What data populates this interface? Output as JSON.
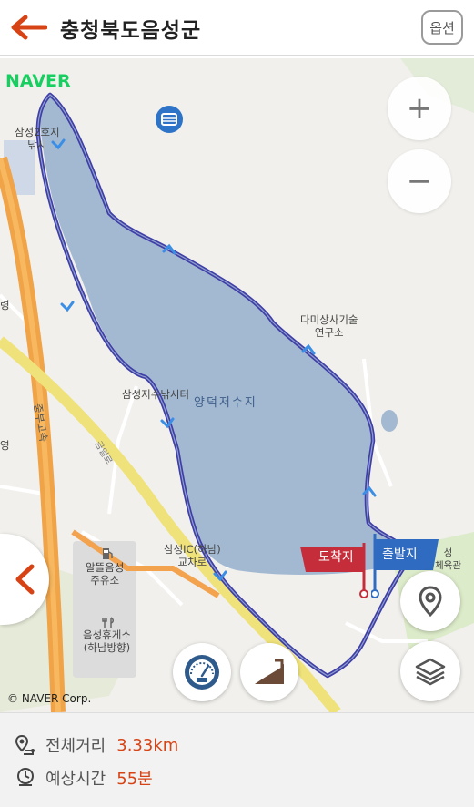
{
  "header": {
    "title": "충청북도음성군",
    "options_label": "옵션"
  },
  "map": {
    "logo": "NAVER",
    "copyright": "© NAVER Corp.",
    "zoom_in": "+",
    "zoom_out": "−",
    "labels": {
      "fishing_site": "삼성2호지\n낚시",
      "research_center": "다미상사기술\n연구소",
      "fishing_center": "삼성저수낚시터",
      "lake": "양덕저수지",
      "highway": "중부고속",
      "road": "금일로",
      "ic": "삼성IC(하남)\n교차로",
      "gas_station": "알뜰음성\n주유소",
      "rest_area": "음성휴게소\n(하남방향)",
      "left_edge": "영",
      "left_edge2": "령",
      "right_partial": "성\n체육관"
    },
    "markers": {
      "arrival": "도착지",
      "departure": "출발지"
    }
  },
  "info": {
    "distance_label": "전체거리",
    "distance_value": "3.33km",
    "time_label": "예상시간",
    "time_value": "55분"
  },
  "colors": {
    "accent": "#d84315",
    "route": "#3f3ea8",
    "lake": "#a3b9d2",
    "highway": "#f0a347",
    "arrival_flag": "#c62d3a",
    "departure_flag": "#2f6bc0"
  }
}
